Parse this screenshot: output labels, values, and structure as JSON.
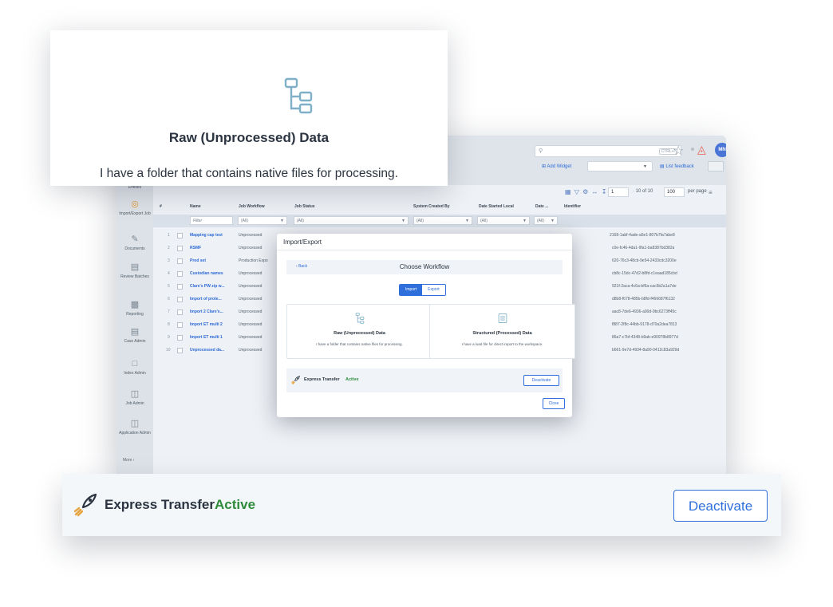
{
  "topbar": {
    "shortcut": "CTRL+/",
    "avatar_initials": "MN",
    "add_widget": "Add Widget",
    "list_feedback": "List feedback"
  },
  "sidenav": {
    "items": [
      {
        "label": "Entities"
      },
      {
        "label": "Import/Export Job",
        "active": true
      },
      {
        "label": "Documents"
      },
      {
        "label": "Review Batches"
      },
      {
        "label": "Reporting"
      },
      {
        "label": "Case Admin"
      },
      {
        "label": "Index Admin"
      },
      {
        "label": "Job Admin"
      },
      {
        "label": "Application Admin"
      }
    ],
    "more": "More"
  },
  "table": {
    "pager": {
      "page": "1",
      "range": "· 10 of 10",
      "per_page": "100",
      "per_page_label": "per page"
    },
    "columns": [
      "#",
      "Name",
      "Job Workflow",
      "Job Status",
      "System Created By",
      "Date Started Local",
      "Date ...",
      "Identifier"
    ],
    "filters": {
      "name": "Filter",
      "all": "(All)"
    },
    "rows": [
      {
        "n": "1",
        "name": "Mapping cap test",
        "workflow": "Unprocessed",
        "id": "2168-1abf-4ade-a5e1-807b7fa7abe8"
      },
      {
        "n": "2",
        "name": "RSMF",
        "workflow": "Unprocessed",
        "id": "c0e-fc46-4da1-9fa1-ba8387bd382a"
      },
      {
        "n": "3",
        "name": "Prod set",
        "workflow": "Production Expo",
        "id": "620-76c3-48cb-9e54-2433cdc3200e"
      },
      {
        "n": "4",
        "name": "Custodian names",
        "workflow": "Unprocessed",
        "id": "cb8c-15dc-47d2-b8fd-c1eaad185cbd"
      },
      {
        "n": "5",
        "name": "Clare's PW zip w...",
        "workflow": "Unprocessed",
        "id": "921f-2aca-4c6a-bf6a-cac5b2a1a7de"
      },
      {
        "n": "6",
        "name": "Import of prote...",
        "workflow": "Unprocessed",
        "id": "d8b8-f678-485b-b8fd-f466687f6132"
      },
      {
        "n": "7",
        "name": "Import 2 Clare's...",
        "workflow": "Unprocessed",
        "id": "aac8-7de6-4936-a90d-9bc6273ff45c"
      },
      {
        "n": "8",
        "name": "Import ET multi 2",
        "workflow": "Unprocessed",
        "id": "f887-2f8c-44bb-9178-d70a2dea7813"
      },
      {
        "n": "9",
        "name": "Import ET multi 1",
        "workflow": "Unprocessed",
        "id": "86a7-c7bf-4348-b9ab-e90978b8977d"
      },
      {
        "n": "10",
        "name": "Unprocessed da...",
        "workflow": "Unprocessed",
        "id": "b661-9e7d-4934-8a90-0412c83a929d"
      }
    ]
  },
  "modal": {
    "title": "Import/Export",
    "back": "Back",
    "heading": "Choose Workflow",
    "tabs": [
      "Import",
      "Export"
    ],
    "cards": [
      {
        "title": "Raw (Unprocessed) Data",
        "desc": "I have a folder that contains native files for processing."
      },
      {
        "title": "Structured (Processed) Data",
        "desc": "I have a load file for direct import to the workspace."
      }
    ],
    "express": {
      "label": "Express Transfer",
      "status": "Active",
      "button": "Deactivate"
    },
    "close": "Close"
  },
  "zoom_top": {
    "title": "Raw (Unprocessed) Data",
    "desc": "I have a folder that contains native files for processing."
  },
  "zoom_bottom": {
    "label": "Express Transfer",
    "status": "Active",
    "button": "Deactivate"
  },
  "colors": {
    "accent": "#2f6fdb",
    "active": "#2e8b3a",
    "icon": "#7fb0c8"
  }
}
